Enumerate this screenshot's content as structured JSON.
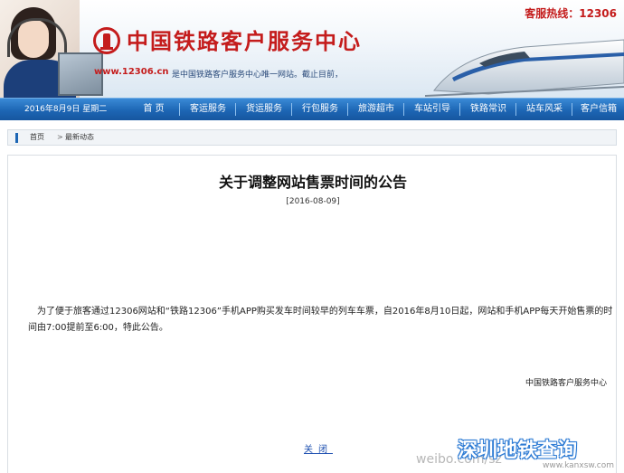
{
  "header": {
    "hotline": "客服热线：12306",
    "site_title": "中国铁路客户服务中心",
    "url": "www.12306.cn",
    "url_desc": "是中国铁路客户服务中心唯一网站。截止目前，"
  },
  "nav": {
    "date": "2016年8月9日  星期二",
    "items": [
      "首 页",
      "客运服务",
      "货运服务",
      "行包服务",
      "旅游超市",
      "车站引导",
      "铁路常识",
      "站车风采",
      "客户信箱"
    ]
  },
  "breadcrumb": {
    "home": "首页",
    "arrow": ">",
    "current": "最新动态"
  },
  "notice": {
    "title": "关于调整网站售票时间的公告",
    "date": "[2016-08-09]",
    "body": "为了便于旅客通过12306网站和“铁路12306”手机APP购买发车时间较早的列车车票，自2016年8月10日起，网站和手机APP每天开始售票的时间由7:00提前至6:00，特此公告。",
    "signature": "中国铁路客户服务中心",
    "close": "关闭"
  },
  "watermark": {
    "main": "深圳地铁查询",
    "weibo": "weibo.com/sz",
    "site": "www.kanxsw.com"
  },
  "colors": {
    "brand_red": "#c41c1c",
    "nav_blue": "#1d66b4",
    "link_blue": "#1d4fb0"
  }
}
